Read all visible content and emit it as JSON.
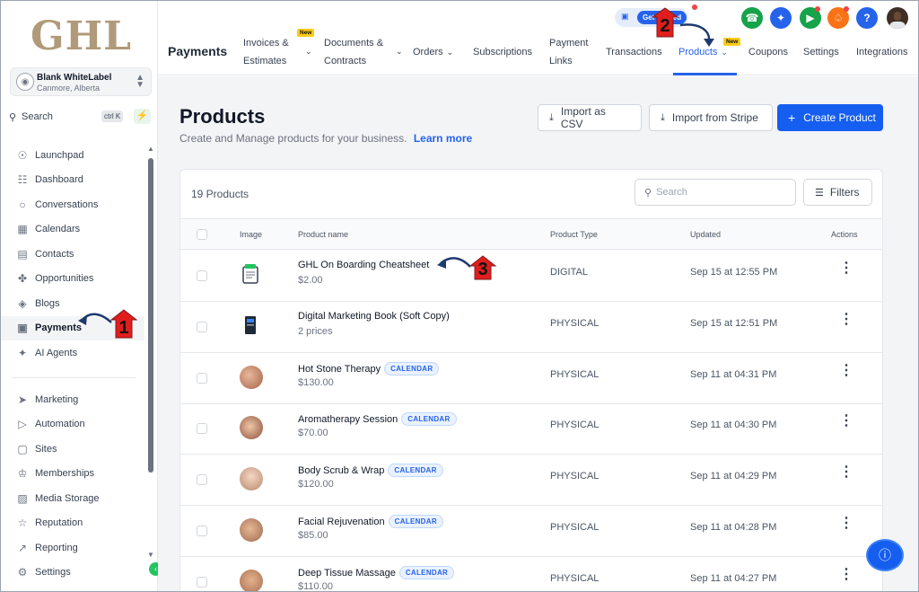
{
  "brand": {
    "logo_text": "GHL"
  },
  "account": {
    "name": "Blank WhiteLabel",
    "location": "Canmore, Alberta"
  },
  "sidebar": {
    "search_label": "Search",
    "search_shortcut": "ctrl K",
    "items": [
      {
        "label": "Launchpad",
        "icon": "rocket-icon"
      },
      {
        "label": "Dashboard",
        "icon": "grid-icon"
      },
      {
        "label": "Conversations",
        "icon": "chat-icon"
      },
      {
        "label": "Calendars",
        "icon": "calendar-icon"
      },
      {
        "label": "Contacts",
        "icon": "contacts-icon"
      },
      {
        "label": "Opportunities",
        "icon": "opportunities-icon"
      },
      {
        "label": "Blogs",
        "icon": "box-icon"
      },
      {
        "label": "Payments",
        "icon": "payments-icon",
        "active": true
      },
      {
        "label": "AI Agents",
        "icon": "sparkle-icon"
      }
    ],
    "items2": [
      {
        "label": "Marketing",
        "icon": "send-icon"
      },
      {
        "label": "Automation",
        "icon": "automation-icon"
      },
      {
        "label": "Sites",
        "icon": "sites-icon"
      },
      {
        "label": "Memberships",
        "icon": "membership-icon"
      },
      {
        "label": "Media Storage",
        "icon": "image-icon"
      },
      {
        "label": "Reputation",
        "icon": "star-icon"
      },
      {
        "label": "Reporting",
        "icon": "chart-icon"
      },
      {
        "label": "Settings",
        "icon": "gear-icon"
      }
    ]
  },
  "topnav": {
    "title": "Payments",
    "tabs": [
      {
        "line1": "Invoices &",
        "line2": "Estimates",
        "new": true,
        "dropdown": true
      },
      {
        "line1": "Documents &",
        "line2": "Contracts",
        "dropdown": true
      },
      {
        "line1": "Orders",
        "dropdown": true
      },
      {
        "line1": "Subscriptions"
      },
      {
        "line1": "Payment",
        "line2": "Links"
      },
      {
        "line1": "Transactions"
      },
      {
        "line1": "Products",
        "new": true,
        "dropdown": true,
        "active": true
      },
      {
        "line1": "Coupons"
      },
      {
        "line1": "Settings"
      },
      {
        "line1": "Integrations"
      }
    ],
    "new_label": "New",
    "get_started": "Get Started"
  },
  "header": {
    "title": "Products",
    "subtitle": "Create and Manage products for your business.",
    "learn_more": "Learn more",
    "import_csv": "Import as CSV",
    "import_stripe": "Import from Stripe",
    "create_product": "Create Product"
  },
  "table": {
    "count_label": "19 Products",
    "search_placeholder": "Search",
    "filters_label": "Filters",
    "columns": {
      "image": "Image",
      "name": "Product name",
      "type": "Product Type",
      "updated": "Updated",
      "actions": "Actions"
    },
    "calendar_tag": "CALENDAR",
    "rows": [
      {
        "name": "GHL On Boarding Cheatsheet",
        "price": "$2.00",
        "type": "DIGITAL",
        "updated": "Sep 15 at 12:55 PM",
        "calendar": false
      },
      {
        "name": "Digital Marketing Book (Soft Copy)",
        "price": "2 prices",
        "type": "PHYSICAL",
        "updated": "Sep 15 at 12:51 PM",
        "calendar": false
      },
      {
        "name": "Hot Stone Therapy",
        "price": "$130.00",
        "type": "PHYSICAL",
        "updated": "Sep 11 at 04:31 PM",
        "calendar": true
      },
      {
        "name": "Aromatherapy Session",
        "price": "$70.00",
        "type": "PHYSICAL",
        "updated": "Sep 11 at 04:30 PM",
        "calendar": true
      },
      {
        "name": "Body Scrub & Wrap",
        "price": "$120.00",
        "type": "PHYSICAL",
        "updated": "Sep 11 at 04:29 PM",
        "calendar": true
      },
      {
        "name": "Facial Rejuvenation",
        "price": "$85.00",
        "type": "PHYSICAL",
        "updated": "Sep 11 at 04:28 PM",
        "calendar": true
      },
      {
        "name": "Deep Tissue Massage",
        "price": "$110.00",
        "type": "PHYSICAL",
        "updated": "Sep 11 at 04:27 PM",
        "calendar": true
      }
    ]
  },
  "annotations": [
    "1",
    "2",
    "3"
  ],
  "colors": {
    "primary": "#155eef",
    "annotation_red": "#e11d1d",
    "arrow": "#1e3a6e"
  }
}
